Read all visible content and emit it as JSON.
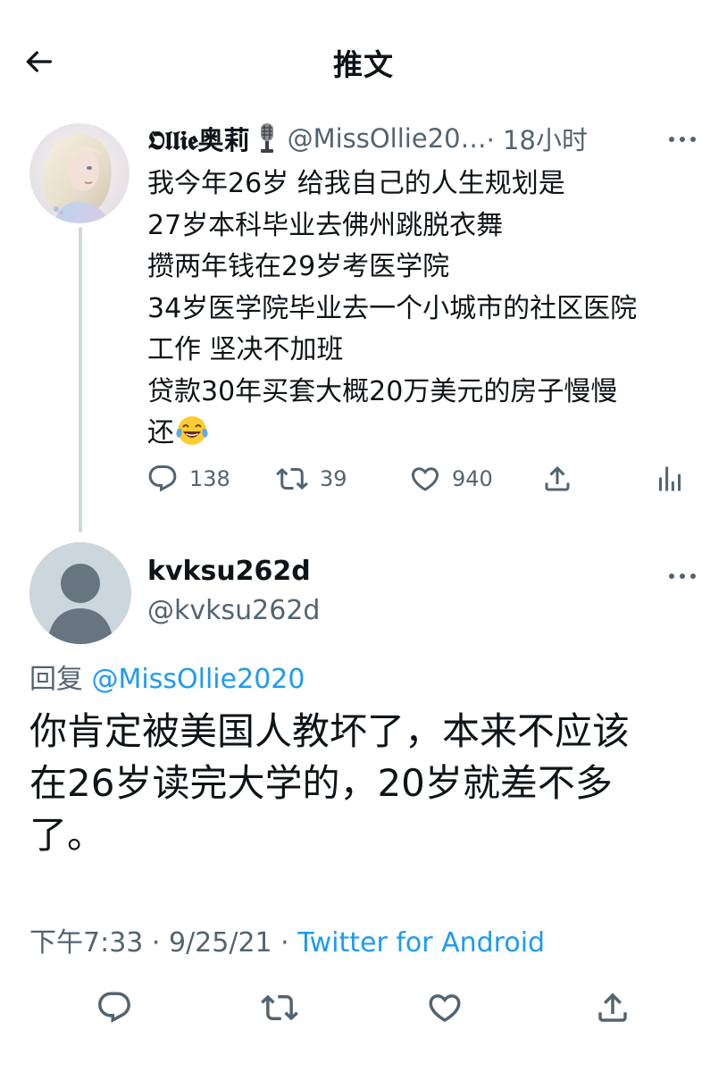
{
  "header": {
    "title": "推文"
  },
  "parent_tweet": {
    "display_name": "𝕺𝖑𝖑𝖎𝖊奥莉",
    "handle": "@MissOllie20…",
    "time": "· 18小时",
    "text_lines": [
      "我今年26岁 给我自己的人生规划是",
      "27岁本科毕业去佛州跳脱衣舞",
      "攒两年钱在29岁考医学院",
      "34岁医学院毕业去一个小城市的社区医院",
      "工作 坚决不加班",
      "贷款30年买套大概20万美元的房子慢慢",
      "还"
    ],
    "actions": {
      "replies": "138",
      "retweets": "39",
      "likes": "940"
    }
  },
  "reply_tweet": {
    "display_name": "kvksu262d",
    "handle": "@kvksu262d",
    "reply_prefix": "回复",
    "reply_mention": "@MissOllie2020",
    "text_lines": [
      "你肯定被美国人教坏了，本来不应该",
      "在26岁读完大学的，20岁就差不多",
      "了。"
    ],
    "timestamp": "下午7:33 · 9/25/21 · ",
    "source": "Twitter for Android"
  },
  "colors": {
    "text_primary": "#0f1419",
    "text_secondary": "#536471",
    "link": "#1d9bf0",
    "thread_line": "#cfd9de"
  },
  "icons": {
    "back": "arrow-left-icon",
    "mic": "microphone-emoji-icon",
    "emoji": "tears-of-joy-emoji-icon",
    "more": "more-horizontal-icon",
    "reply": "reply-bubble-icon",
    "retweet": "retweet-icon",
    "like": "heart-icon",
    "share": "share-icon",
    "analytics": "analytics-icon"
  }
}
